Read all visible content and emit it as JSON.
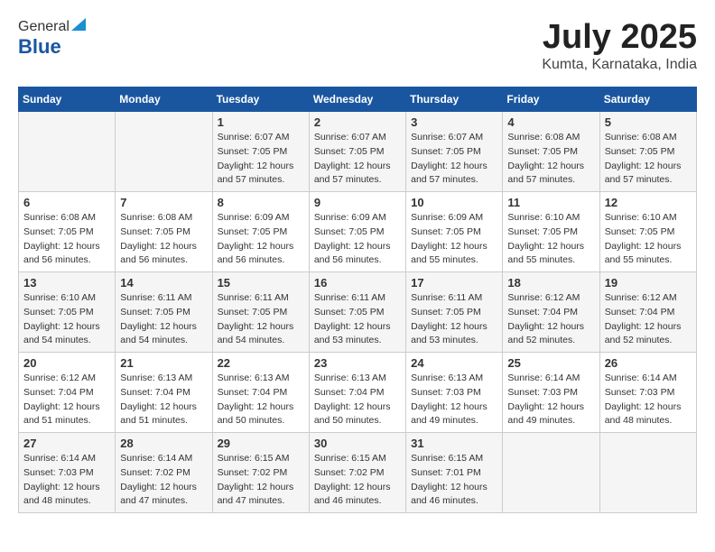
{
  "header": {
    "logo_general": "General",
    "logo_blue": "Blue",
    "month": "July 2025",
    "location": "Kumta, Karnataka, India"
  },
  "columns": [
    "Sunday",
    "Monday",
    "Tuesday",
    "Wednesday",
    "Thursday",
    "Friday",
    "Saturday"
  ],
  "weeks": [
    [
      {
        "day": "",
        "detail": ""
      },
      {
        "day": "",
        "detail": ""
      },
      {
        "day": "1",
        "detail": "Sunrise: 6:07 AM\nSunset: 7:05 PM\nDaylight: 12 hours\nand 57 minutes."
      },
      {
        "day": "2",
        "detail": "Sunrise: 6:07 AM\nSunset: 7:05 PM\nDaylight: 12 hours\nand 57 minutes."
      },
      {
        "day": "3",
        "detail": "Sunrise: 6:07 AM\nSunset: 7:05 PM\nDaylight: 12 hours\nand 57 minutes."
      },
      {
        "day": "4",
        "detail": "Sunrise: 6:08 AM\nSunset: 7:05 PM\nDaylight: 12 hours\nand 57 minutes."
      },
      {
        "day": "5",
        "detail": "Sunrise: 6:08 AM\nSunset: 7:05 PM\nDaylight: 12 hours\nand 57 minutes."
      }
    ],
    [
      {
        "day": "6",
        "detail": "Sunrise: 6:08 AM\nSunset: 7:05 PM\nDaylight: 12 hours\nand 56 minutes."
      },
      {
        "day": "7",
        "detail": "Sunrise: 6:08 AM\nSunset: 7:05 PM\nDaylight: 12 hours\nand 56 minutes."
      },
      {
        "day": "8",
        "detail": "Sunrise: 6:09 AM\nSunset: 7:05 PM\nDaylight: 12 hours\nand 56 minutes."
      },
      {
        "day": "9",
        "detail": "Sunrise: 6:09 AM\nSunset: 7:05 PM\nDaylight: 12 hours\nand 56 minutes."
      },
      {
        "day": "10",
        "detail": "Sunrise: 6:09 AM\nSunset: 7:05 PM\nDaylight: 12 hours\nand 55 minutes."
      },
      {
        "day": "11",
        "detail": "Sunrise: 6:10 AM\nSunset: 7:05 PM\nDaylight: 12 hours\nand 55 minutes."
      },
      {
        "day": "12",
        "detail": "Sunrise: 6:10 AM\nSunset: 7:05 PM\nDaylight: 12 hours\nand 55 minutes."
      }
    ],
    [
      {
        "day": "13",
        "detail": "Sunrise: 6:10 AM\nSunset: 7:05 PM\nDaylight: 12 hours\nand 54 minutes."
      },
      {
        "day": "14",
        "detail": "Sunrise: 6:11 AM\nSunset: 7:05 PM\nDaylight: 12 hours\nand 54 minutes."
      },
      {
        "day": "15",
        "detail": "Sunrise: 6:11 AM\nSunset: 7:05 PM\nDaylight: 12 hours\nand 54 minutes."
      },
      {
        "day": "16",
        "detail": "Sunrise: 6:11 AM\nSunset: 7:05 PM\nDaylight: 12 hours\nand 53 minutes."
      },
      {
        "day": "17",
        "detail": "Sunrise: 6:11 AM\nSunset: 7:05 PM\nDaylight: 12 hours\nand 53 minutes."
      },
      {
        "day": "18",
        "detail": "Sunrise: 6:12 AM\nSunset: 7:04 PM\nDaylight: 12 hours\nand 52 minutes."
      },
      {
        "day": "19",
        "detail": "Sunrise: 6:12 AM\nSunset: 7:04 PM\nDaylight: 12 hours\nand 52 minutes."
      }
    ],
    [
      {
        "day": "20",
        "detail": "Sunrise: 6:12 AM\nSunset: 7:04 PM\nDaylight: 12 hours\nand 51 minutes."
      },
      {
        "day": "21",
        "detail": "Sunrise: 6:13 AM\nSunset: 7:04 PM\nDaylight: 12 hours\nand 51 minutes."
      },
      {
        "day": "22",
        "detail": "Sunrise: 6:13 AM\nSunset: 7:04 PM\nDaylight: 12 hours\nand 50 minutes."
      },
      {
        "day": "23",
        "detail": "Sunrise: 6:13 AM\nSunset: 7:04 PM\nDaylight: 12 hours\nand 50 minutes."
      },
      {
        "day": "24",
        "detail": "Sunrise: 6:13 AM\nSunset: 7:03 PM\nDaylight: 12 hours\nand 49 minutes."
      },
      {
        "day": "25",
        "detail": "Sunrise: 6:14 AM\nSunset: 7:03 PM\nDaylight: 12 hours\nand 49 minutes."
      },
      {
        "day": "26",
        "detail": "Sunrise: 6:14 AM\nSunset: 7:03 PM\nDaylight: 12 hours\nand 48 minutes."
      }
    ],
    [
      {
        "day": "27",
        "detail": "Sunrise: 6:14 AM\nSunset: 7:03 PM\nDaylight: 12 hours\nand 48 minutes."
      },
      {
        "day": "28",
        "detail": "Sunrise: 6:14 AM\nSunset: 7:02 PM\nDaylight: 12 hours\nand 47 minutes."
      },
      {
        "day": "29",
        "detail": "Sunrise: 6:15 AM\nSunset: 7:02 PM\nDaylight: 12 hours\nand 47 minutes."
      },
      {
        "day": "30",
        "detail": "Sunrise: 6:15 AM\nSunset: 7:02 PM\nDaylight: 12 hours\nand 46 minutes."
      },
      {
        "day": "31",
        "detail": "Sunrise: 6:15 AM\nSunset: 7:01 PM\nDaylight: 12 hours\nand 46 minutes."
      },
      {
        "day": "",
        "detail": ""
      },
      {
        "day": "",
        "detail": ""
      }
    ]
  ]
}
